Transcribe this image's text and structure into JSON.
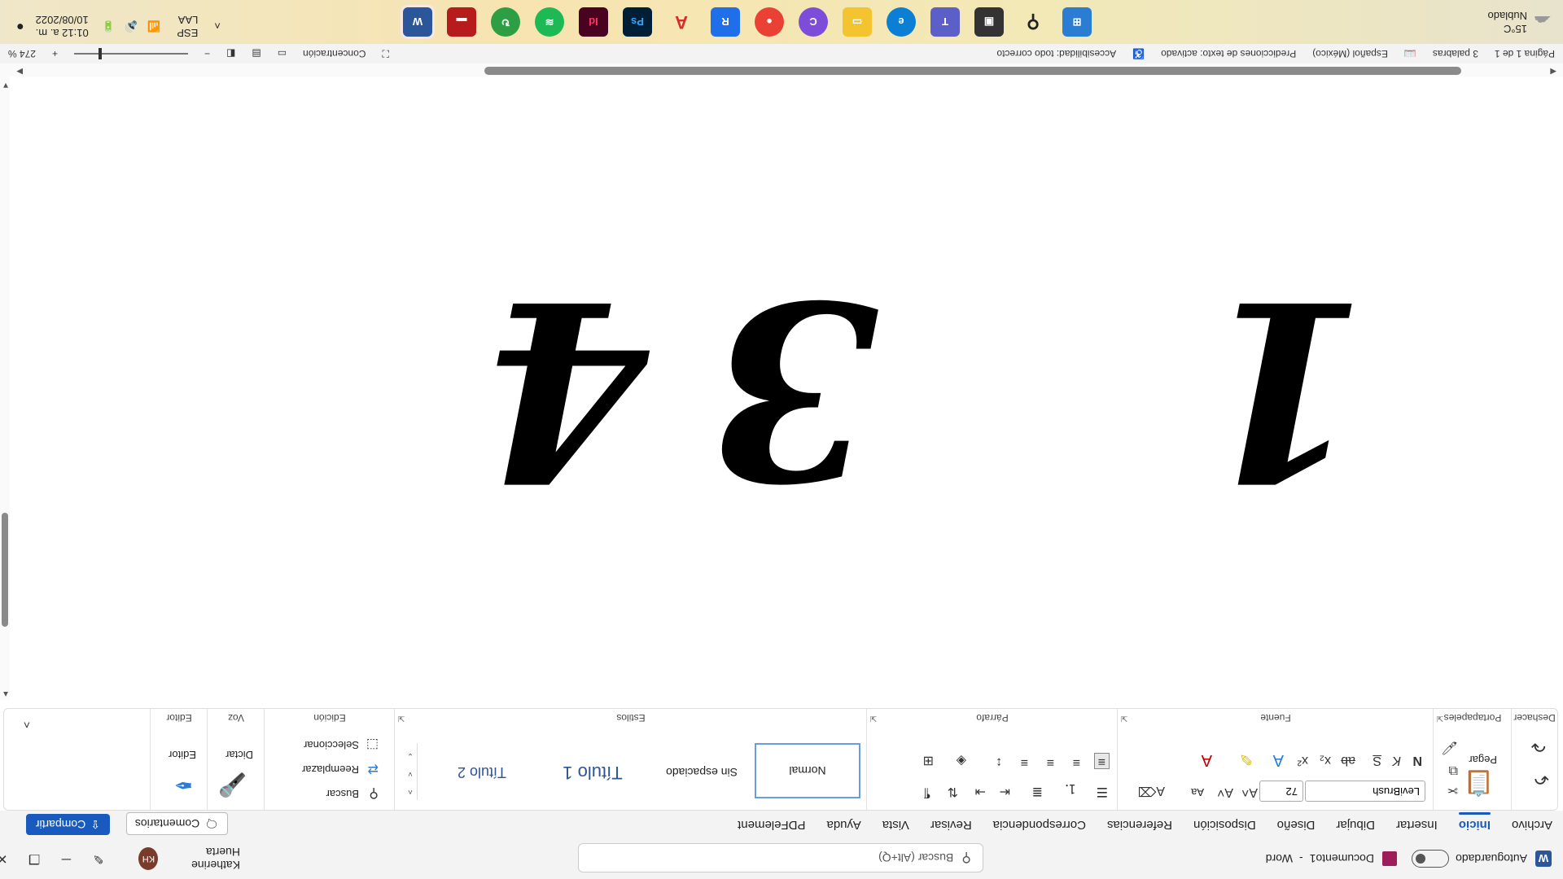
{
  "titlebar": {
    "autosave_label": "Autoguardado",
    "doc_title": "Documento1",
    "separator": "-",
    "app_name": "Word",
    "search_placeholder": "Buscar (Alt+Q)",
    "user_name": "Katherine Huerta",
    "user_initials": "KH"
  },
  "menu": {
    "tabs": [
      "Archivo",
      "Inicio",
      "Insertar",
      "Dibujar",
      "Diseño",
      "Disposición",
      "Referencias",
      "Correspondencia",
      "Revisar",
      "Vista",
      "Ayuda",
      "PDFelement"
    ],
    "active_index": 1,
    "comments_label": "Comentarios",
    "share_label": "Compartir"
  },
  "ribbon": {
    "undo_group": "Deshacer",
    "clipboard_group": "Portapapeles",
    "paste_label": "Pegar",
    "font_group": "Fuente",
    "font_name": "LeviBrush",
    "font_size": "72",
    "bold": "N",
    "italic": "K",
    "underline": "S",
    "case_label": "Aa",
    "paragraph_group": "Párrafo",
    "styles_group": "Estilos",
    "styles": [
      "Normal",
      "Sin espaciado",
      "Título 1",
      "Título 2"
    ],
    "editing_group": "Edición",
    "find_label": "Buscar",
    "replace_label": "Reemplazar",
    "select_label": "Seleccionar",
    "voice_group": "Voz",
    "dictate_label": "Dictar",
    "editor_group": "Editor",
    "editor_label": "Editor"
  },
  "document": {
    "digits": [
      "1",
      "3",
      "4"
    ]
  },
  "statusbar": {
    "page": "Página 1 de 1",
    "words": "3 palabras",
    "language": "Español (México)",
    "predictions": "Predicciones de texto: activado",
    "accessibility": "Accesibilidad: todo correcto",
    "focus": "Concentración",
    "zoom": "274 %"
  },
  "taskbar": {
    "weather_temp": "15°C",
    "weather_desc": "Nublado",
    "lang_top": "ESP",
    "lang_bottom": "LAA",
    "time": "01:12 a. m.",
    "date": "10/08/2022",
    "apps": [
      "Word",
      "App",
      "Greenshot",
      "Spotify",
      "InDesign",
      "Photoshop",
      "Acrobat",
      "Reader",
      "Chrome",
      "Canva",
      "Explorer",
      "Edge",
      "Teams",
      "Terminal",
      "Search",
      "Start"
    ]
  }
}
